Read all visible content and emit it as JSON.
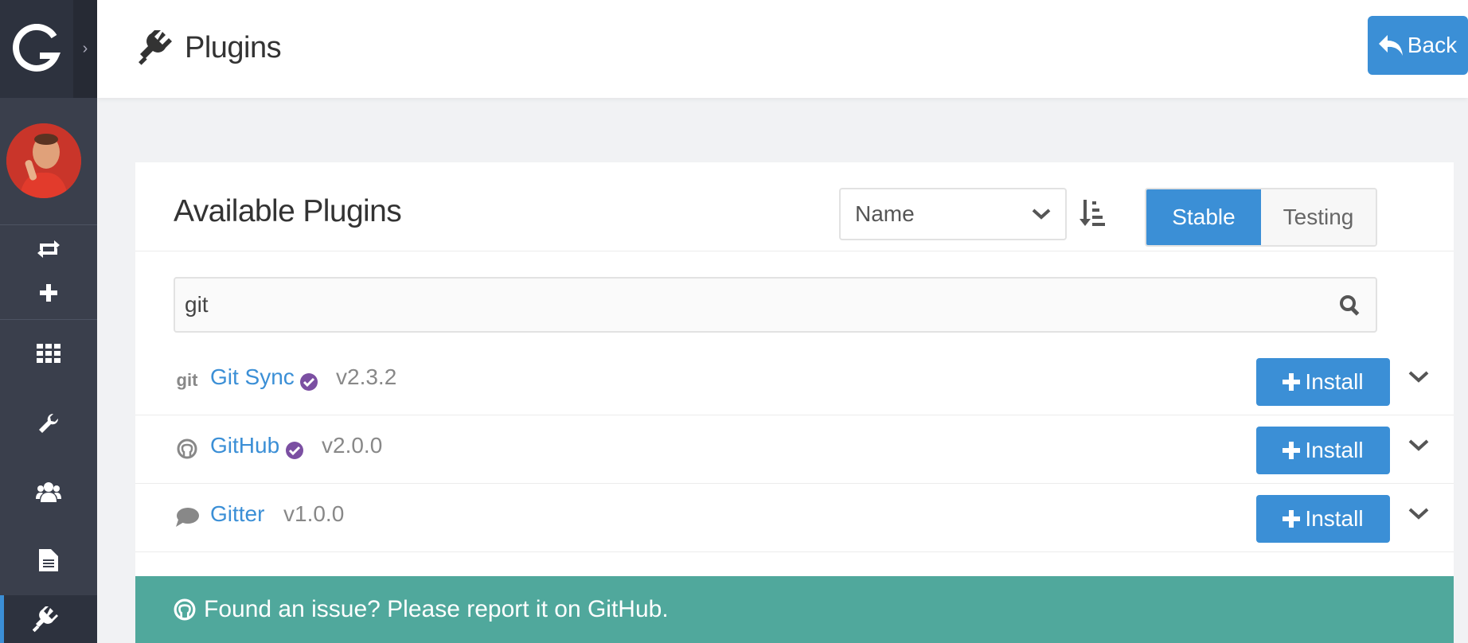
{
  "header": {
    "title": "Plugins",
    "back_label": "Back"
  },
  "sidebar": {
    "logo": "G",
    "toggle_glyph": "›",
    "items": [
      {
        "icon": "refresh-icon"
      },
      {
        "icon": "plus-icon"
      },
      {
        "icon": "grid-icon"
      },
      {
        "icon": "wrench-icon"
      },
      {
        "icon": "users-icon"
      },
      {
        "icon": "file-icon"
      },
      {
        "icon": "plug-icon",
        "active": true
      }
    ]
  },
  "card": {
    "title": "Available Plugins",
    "sort": {
      "selected": "Name"
    },
    "channel": {
      "stable": "Stable",
      "testing": "Testing",
      "active": "Stable"
    }
  },
  "search": {
    "value": "git"
  },
  "plugins": [
    {
      "icon_text": "git",
      "name": "Git Sync",
      "verified": true,
      "version": "v2.3.2",
      "action": "Install"
    },
    {
      "icon_text": "",
      "name": "GitHub",
      "verified": true,
      "version": "v2.0.0",
      "action": "Install"
    },
    {
      "icon_text": "",
      "name": "Gitter",
      "verified": false,
      "version": "v1.0.0",
      "action": "Install"
    }
  ],
  "notice": {
    "text": "Found an issue? Please report it on GitHub."
  },
  "colors": {
    "primary": "#3b8fd6",
    "sidebar": "#3a3f4c",
    "notice": "#50a89c",
    "verified": "#7b4fa2"
  }
}
